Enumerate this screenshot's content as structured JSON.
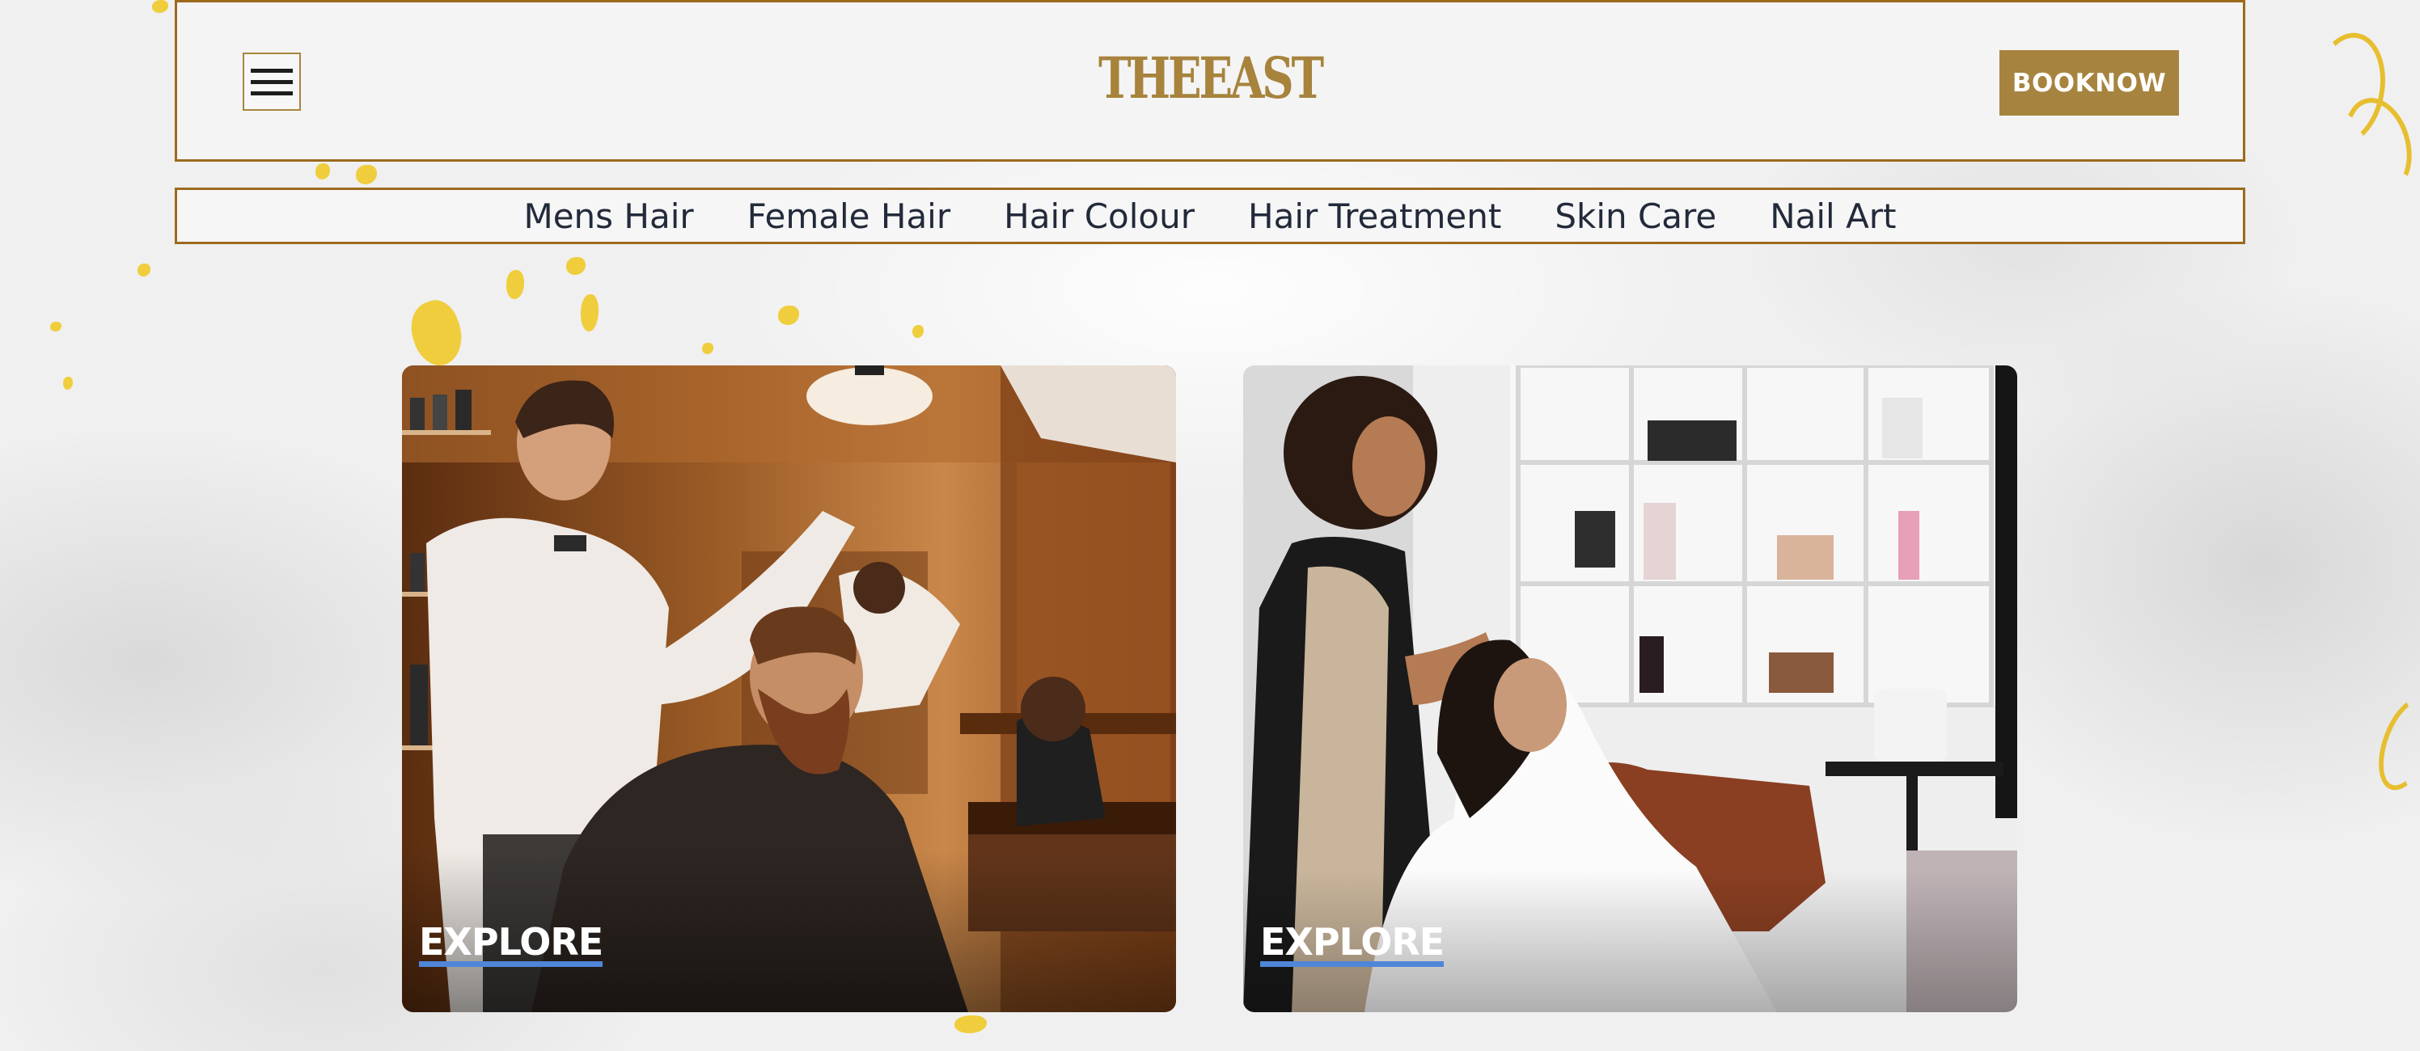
{
  "header": {
    "brand": "THEEAST",
    "book_label": "BOOKNOW",
    "menu_icon": "hamburger-menu-icon"
  },
  "nav": {
    "items": [
      {
        "label": "Mens Hair"
      },
      {
        "label": "Female Hair"
      },
      {
        "label": "Hair Colour"
      },
      {
        "label": "Hair Treatment"
      },
      {
        "label": "Skin Care"
      },
      {
        "label": "Nail Art"
      }
    ]
  },
  "cards": [
    {
      "cta": "EXPLORE"
    },
    {
      "cta": "EXPLORE"
    }
  ],
  "colors": {
    "brand_gold": "#a7833c",
    "border_bronze": "#9c6a1d",
    "nav_text": "#222a3a",
    "explore_underline": "#4f86d8",
    "background": "#f0f0f0"
  }
}
